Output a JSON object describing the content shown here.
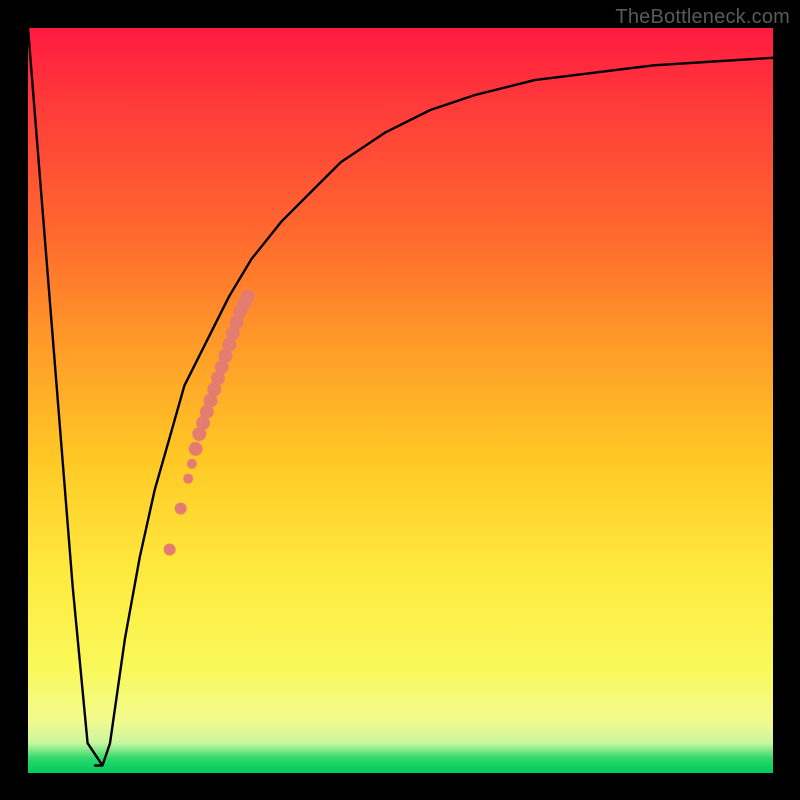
{
  "watermark": "TheBottleneck.com",
  "chart_data": {
    "type": "line",
    "title": "",
    "xlabel": "",
    "ylabel": "",
    "xlim": [
      0,
      100
    ],
    "ylim": [
      0,
      100
    ],
    "grid": false,
    "legend": false,
    "curve": {
      "x": [
        0,
        6,
        8,
        9,
        10,
        11,
        13,
        15,
        17,
        19,
        21,
        24,
        27,
        30,
        34,
        38,
        42,
        48,
        54,
        60,
        68,
        76,
        84,
        92,
        100
      ],
      "y": [
        100,
        25,
        4,
        1,
        1,
        4,
        18,
        29,
        38,
        45,
        52,
        58,
        64,
        69,
        74,
        78,
        82,
        86,
        89,
        91,
        93,
        94,
        95,
        95.5,
        96
      ]
    },
    "flat_bottom": {
      "x0": 8,
      "x1": 10,
      "y": 1
    },
    "markers": [
      {
        "x": 19.0,
        "y": 30.0,
        "r": 6
      },
      {
        "x": 20.5,
        "y": 35.5,
        "r": 6
      },
      {
        "x": 21.5,
        "y": 39.5,
        "r": 5
      },
      {
        "x": 22.0,
        "y": 41.5,
        "r": 5
      },
      {
        "x": 22.5,
        "y": 43.5,
        "r": 7
      },
      {
        "x": 23.0,
        "y": 45.5,
        "r": 7
      },
      {
        "x": 23.5,
        "y": 47.0,
        "r": 7
      },
      {
        "x": 24.0,
        "y": 48.5,
        "r": 7
      },
      {
        "x": 24.5,
        "y": 50.0,
        "r": 7
      },
      {
        "x": 25.0,
        "y": 51.5,
        "r": 7
      },
      {
        "x": 25.5,
        "y": 53.0,
        "r": 7
      },
      {
        "x": 26.0,
        "y": 54.5,
        "r": 7
      },
      {
        "x": 26.5,
        "y": 56.0,
        "r": 7
      },
      {
        "x": 27.0,
        "y": 57.5,
        "r": 7
      },
      {
        "x": 27.5,
        "y": 59.0,
        "r": 7
      },
      {
        "x": 28.0,
        "y": 60.5,
        "r": 7
      },
      {
        "x": 28.5,
        "y": 62.0,
        "r": 7
      },
      {
        "x": 29.0,
        "y": 63.0,
        "r": 7
      },
      {
        "x": 29.5,
        "y": 64.0,
        "r": 7
      }
    ],
    "colors": {
      "line": "#000000",
      "markers": "#e47d6f",
      "background_top": "#ff1a40",
      "background_bottom": "#00c95e"
    }
  }
}
